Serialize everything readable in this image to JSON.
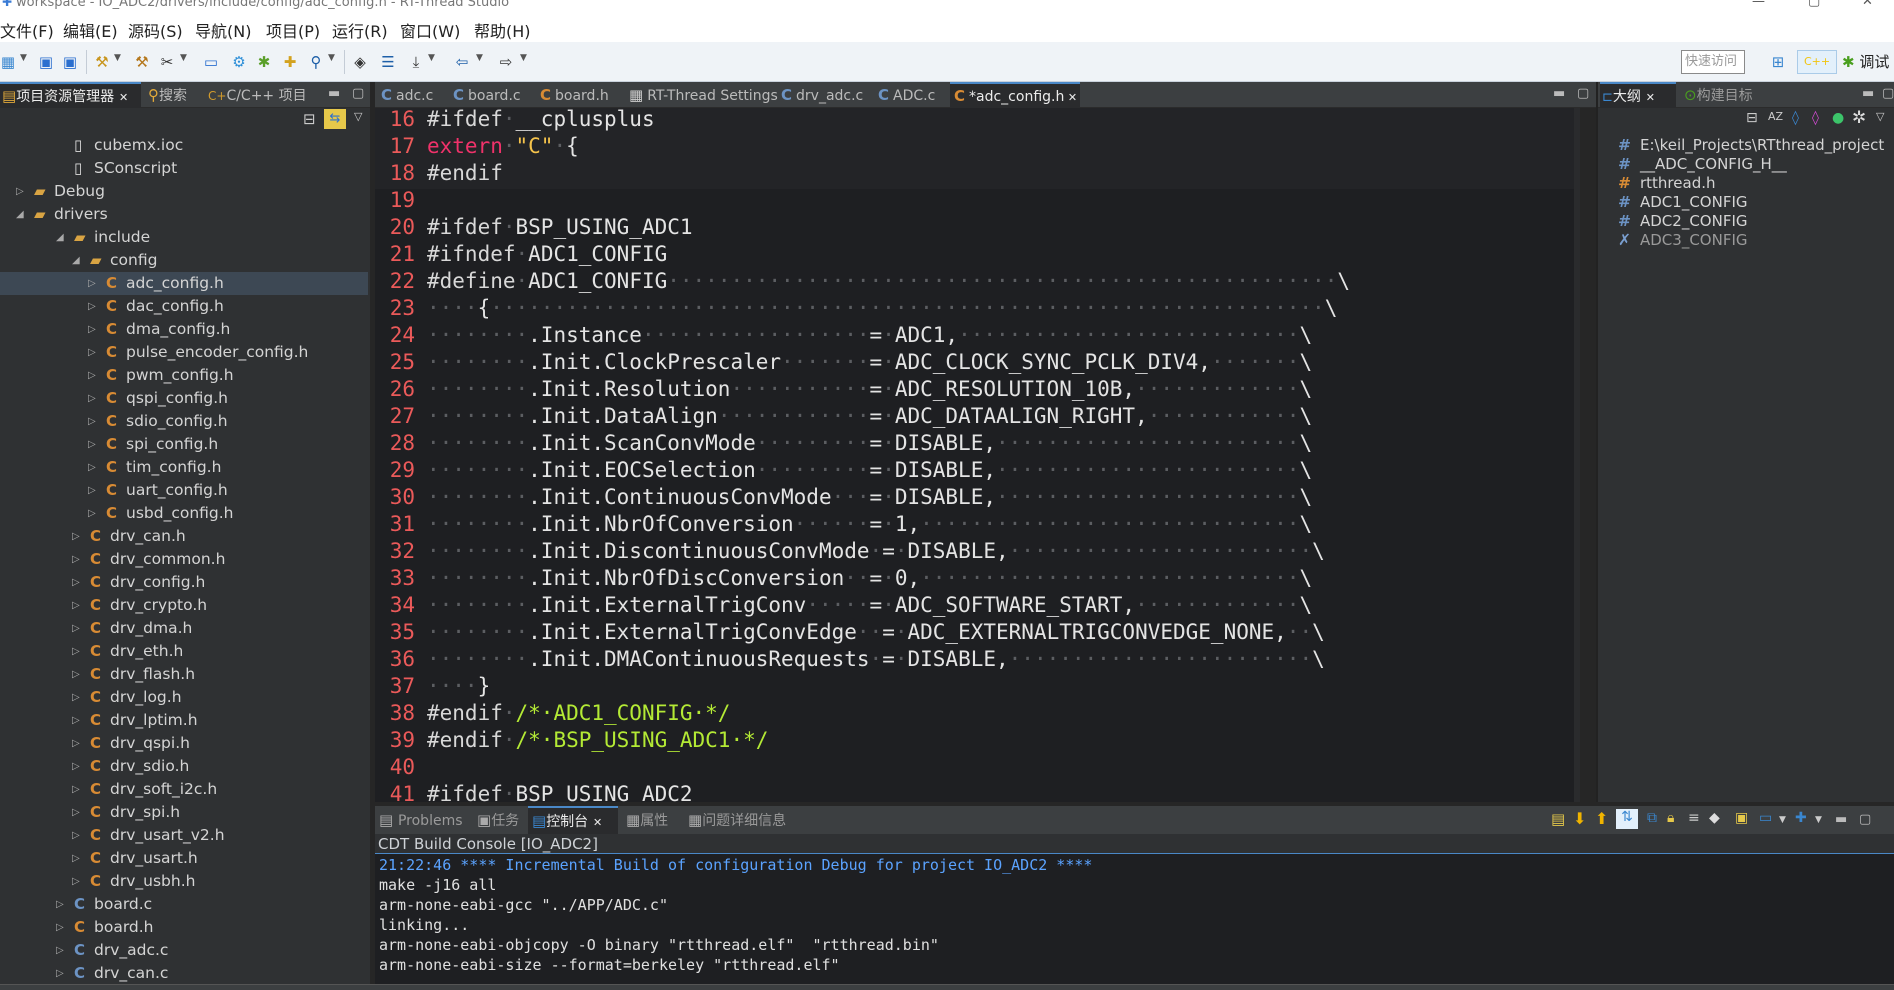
{
  "window": {
    "title": "workspace - IO_ADC2/drivers/include/config/adc_config.h - RT-Thread Studio"
  },
  "menus": [
    "文件(F)",
    "编辑(E)",
    "源码(S)",
    "导航(N)",
    "项目(P)",
    "运行(R)",
    "窗口(W)",
    "帮助(H)"
  ],
  "toolbar": {
    "quick_access": "快速访问",
    "cpp_perspective": "C++",
    "debug_perspective": "调试"
  },
  "left_tabs": [
    "项目资源管理器",
    "搜索",
    "C/C++ 项目"
  ],
  "right_tabs": [
    "大纲",
    "构建目标"
  ],
  "bottom_tabs": [
    "Problems",
    "任务",
    "控制台",
    "属性",
    "问题详细信息"
  ],
  "tree": [
    {
      "indent": 2,
      "label": "cubemx.ioc",
      "icon": "file"
    },
    {
      "indent": 2,
      "label": "SConscript",
      "icon": "file"
    },
    {
      "indent": 1,
      "label": "Debug",
      "icon": "folder",
      "twisty": "closed"
    },
    {
      "indent": 1,
      "label": "drivers",
      "icon": "folder",
      "twisty": "open"
    },
    {
      "indent": 2,
      "label": "include",
      "icon": "folder",
      "twisty": "open"
    },
    {
      "indent": 3,
      "label": "config",
      "icon": "folder",
      "twisty": "open"
    },
    {
      "indent": 4,
      "label": "adc_config.h",
      "icon": "h",
      "twisty": "closed",
      "selected": true
    },
    {
      "indent": 4,
      "label": "dac_config.h",
      "icon": "h",
      "twisty": "closed"
    },
    {
      "indent": 4,
      "label": "dma_config.h",
      "icon": "h",
      "twisty": "closed"
    },
    {
      "indent": 4,
      "label": "pulse_encoder_config.h",
      "icon": "h",
      "twisty": "closed"
    },
    {
      "indent": 4,
      "label": "pwm_config.h",
      "icon": "h",
      "twisty": "closed"
    },
    {
      "indent": 4,
      "label": "qspi_config.h",
      "icon": "h",
      "twisty": "closed"
    },
    {
      "indent": 4,
      "label": "sdio_config.h",
      "icon": "h",
      "twisty": "closed"
    },
    {
      "indent": 4,
      "label": "spi_config.h",
      "icon": "h",
      "twisty": "closed"
    },
    {
      "indent": 4,
      "label": "tim_config.h",
      "icon": "h",
      "twisty": "closed"
    },
    {
      "indent": 4,
      "label": "uart_config.h",
      "icon": "h",
      "twisty": "closed"
    },
    {
      "indent": 4,
      "label": "usbd_config.h",
      "icon": "h",
      "twisty": "closed"
    },
    {
      "indent": 3,
      "label": "drv_can.h",
      "icon": "h",
      "twisty": "closed"
    },
    {
      "indent": 3,
      "label": "drv_common.h",
      "icon": "h",
      "twisty": "closed"
    },
    {
      "indent": 3,
      "label": "drv_config.h",
      "icon": "h",
      "twisty": "closed"
    },
    {
      "indent": 3,
      "label": "drv_crypto.h",
      "icon": "h",
      "twisty": "closed"
    },
    {
      "indent": 3,
      "label": "drv_dma.h",
      "icon": "h",
      "twisty": "closed"
    },
    {
      "indent": 3,
      "label": "drv_eth.h",
      "icon": "h",
      "twisty": "closed"
    },
    {
      "indent": 3,
      "label": "drv_flash.h",
      "icon": "h",
      "twisty": "closed"
    },
    {
      "indent": 3,
      "label": "drv_log.h",
      "icon": "h",
      "twisty": "closed"
    },
    {
      "indent": 3,
      "label": "drv_lptim.h",
      "icon": "h",
      "twisty": "closed"
    },
    {
      "indent": 3,
      "label": "drv_qspi.h",
      "icon": "h",
      "twisty": "closed"
    },
    {
      "indent": 3,
      "label": "drv_sdio.h",
      "icon": "h",
      "twisty": "closed"
    },
    {
      "indent": 3,
      "label": "drv_soft_i2c.h",
      "icon": "h",
      "twisty": "closed"
    },
    {
      "indent": 3,
      "label": "drv_spi.h",
      "icon": "h",
      "twisty": "closed"
    },
    {
      "indent": 3,
      "label": "drv_usart_v2.h",
      "icon": "h",
      "twisty": "closed"
    },
    {
      "indent": 3,
      "label": "drv_usart.h",
      "icon": "h",
      "twisty": "closed"
    },
    {
      "indent": 3,
      "label": "drv_usbh.h",
      "icon": "h",
      "twisty": "closed"
    },
    {
      "indent": 2,
      "label": "board.c",
      "icon": "c",
      "twisty": "closed"
    },
    {
      "indent": 2,
      "label": "board.h",
      "icon": "h",
      "twisty": "closed"
    },
    {
      "indent": 2,
      "label": "drv_adc.c",
      "icon": "c",
      "twisty": "closed"
    },
    {
      "indent": 2,
      "label": "drv_can.c",
      "icon": "c",
      "twisty": "closed"
    }
  ],
  "editor_tabs": [
    {
      "label": "adc.c",
      "icon": "c"
    },
    {
      "label": "board.c",
      "icon": "c"
    },
    {
      "label": "board.h",
      "icon": "h"
    },
    {
      "label": "RT-Thread Settings",
      "icon": "settings"
    },
    {
      "label": "drv_adc.c",
      "icon": "c"
    },
    {
      "label": "ADC.c",
      "icon": "c"
    },
    {
      "label": "*adc_config.h",
      "icon": "h",
      "active": true
    }
  ],
  "code": [
    {
      "n": "16",
      "t": [
        [
          "pp",
          "#ifdef"
        ],
        [
          "ws",
          "·"
        ],
        [
          "",
          "__cplusplus"
        ]
      ]
    },
    {
      "n": "17",
      "t": [
        [
          "kw",
          "extern"
        ],
        [
          "ws",
          "·"
        ],
        [
          "str",
          "\"C\""
        ],
        [
          "ws",
          "·"
        ],
        [
          "",
          "{"
        ]
      ]
    },
    {
      "n": "18",
      "t": [
        [
          "pp",
          "#endif"
        ]
      ]
    },
    {
      "n": "19",
      "t": []
    },
    {
      "n": "20",
      "t": [
        [
          "pp",
          "#ifdef"
        ],
        [
          "ws",
          "·"
        ],
        [
          "",
          "BSP_USING_ADC1"
        ]
      ]
    },
    {
      "n": "21",
      "t": [
        [
          "pp",
          "#ifndef"
        ],
        [
          "ws",
          "·"
        ],
        [
          "",
          "ADC1_CONFIG"
        ]
      ]
    },
    {
      "n": "22",
      "t": [
        [
          "pp",
          "#define"
        ],
        [
          "ws",
          "·"
        ],
        [
          "",
          "ADC1_CONFIG"
        ],
        [
          "ws",
          "·····················································"
        ],
        [
          "",
          "\\"
        ]
      ]
    },
    {
      "n": "23",
      "t": [
        [
          "ws",
          "····"
        ],
        [
          "",
          "{"
        ],
        [
          "ws",
          "··································································"
        ],
        [
          "",
          "\\"
        ]
      ]
    },
    {
      "n": "24",
      "t": [
        [
          "ws",
          "········"
        ],
        [
          "",
          ".Instance"
        ],
        [
          "ws",
          "··················"
        ],
        [
          "",
          "="
        ],
        [
          "ws",
          "·"
        ],
        [
          "",
          "ADC1,"
        ],
        [
          "ws",
          "···························"
        ],
        [
          "",
          "\\"
        ]
      ]
    },
    {
      "n": "25",
      "t": [
        [
          "ws",
          "········"
        ],
        [
          "",
          ".Init.ClockPrescaler"
        ],
        [
          "ws",
          "·······"
        ],
        [
          "",
          "="
        ],
        [
          "ws",
          "·"
        ],
        [
          "",
          "ADC_CLOCK_SYNC_PCLK_DIV4,"
        ],
        [
          "ws",
          "·······"
        ],
        [
          "",
          "\\"
        ]
      ]
    },
    {
      "n": "26",
      "t": [
        [
          "ws",
          "········"
        ],
        [
          "",
          ".Init.Resolution"
        ],
        [
          "ws",
          "···········"
        ],
        [
          "",
          "="
        ],
        [
          "ws",
          "·"
        ],
        [
          "",
          "ADC_RESOLUTION_10B,"
        ],
        [
          "ws",
          "·············"
        ],
        [
          "",
          "\\"
        ]
      ]
    },
    {
      "n": "27",
      "t": [
        [
          "ws",
          "········"
        ],
        [
          "",
          ".Init.DataAlign"
        ],
        [
          "ws",
          "············"
        ],
        [
          "",
          "="
        ],
        [
          "ws",
          "·"
        ],
        [
          "",
          "ADC_DATAALIGN_RIGHT,"
        ],
        [
          "ws",
          "············"
        ],
        [
          "",
          "\\"
        ]
      ]
    },
    {
      "n": "28",
      "t": [
        [
          "ws",
          "········"
        ],
        [
          "",
          ".Init.ScanConvMode"
        ],
        [
          "ws",
          "·········"
        ],
        [
          "",
          "="
        ],
        [
          "ws",
          "·"
        ],
        [
          "",
          "DISABLE,"
        ],
        [
          "ws",
          "························"
        ],
        [
          "",
          "\\"
        ]
      ]
    },
    {
      "n": "29",
      "t": [
        [
          "ws",
          "········"
        ],
        [
          "",
          ".Init.EOCSelection"
        ],
        [
          "ws",
          "·········"
        ],
        [
          "",
          "="
        ],
        [
          "ws",
          "·"
        ],
        [
          "",
          "DISABLE,"
        ],
        [
          "ws",
          "························"
        ],
        [
          "",
          "\\"
        ]
      ]
    },
    {
      "n": "30",
      "t": [
        [
          "ws",
          "········"
        ],
        [
          "",
          ".Init.ContinuousConvMode"
        ],
        [
          "ws",
          "···"
        ],
        [
          "",
          "="
        ],
        [
          "ws",
          "·"
        ],
        [
          "",
          "DISABLE,"
        ],
        [
          "ws",
          "························"
        ],
        [
          "",
          "\\"
        ]
      ]
    },
    {
      "n": "31",
      "t": [
        [
          "ws",
          "········"
        ],
        [
          "",
          ".Init.NbrOfConversion"
        ],
        [
          "ws",
          "······"
        ],
        [
          "",
          "="
        ],
        [
          "ws",
          "·"
        ],
        [
          "",
          "1,"
        ],
        [
          "ws",
          "······························"
        ],
        [
          "",
          "\\"
        ]
      ]
    },
    {
      "n": "32",
      "t": [
        [
          "ws",
          "········"
        ],
        [
          "",
          ".Init.DiscontinuousConvMode"
        ],
        [
          "ws",
          "·"
        ],
        [
          "",
          "="
        ],
        [
          "ws",
          "·"
        ],
        [
          "",
          "DISABLE,"
        ],
        [
          "ws",
          "························"
        ],
        [
          "",
          "\\"
        ]
      ]
    },
    {
      "n": "33",
      "t": [
        [
          "ws",
          "········"
        ],
        [
          "",
          ".Init.NbrOfDiscConversion"
        ],
        [
          "ws",
          "··"
        ],
        [
          "",
          "="
        ],
        [
          "ws",
          "·"
        ],
        [
          "",
          "0,"
        ],
        [
          "ws",
          "······························"
        ],
        [
          "",
          "\\"
        ]
      ]
    },
    {
      "n": "34",
      "t": [
        [
          "ws",
          "········"
        ],
        [
          "",
          ".Init.ExternalTrigConv"
        ],
        [
          "ws",
          "·····"
        ],
        [
          "",
          "="
        ],
        [
          "ws",
          "·"
        ],
        [
          "",
          "ADC_SOFTWARE_START,"
        ],
        [
          "ws",
          "·············"
        ],
        [
          "",
          "\\"
        ]
      ]
    },
    {
      "n": "35",
      "t": [
        [
          "ws",
          "········"
        ],
        [
          "",
          ".Init.ExternalTrigConvEdge"
        ],
        [
          "ws",
          "··"
        ],
        [
          "",
          "="
        ],
        [
          "ws",
          "·"
        ],
        [
          "",
          "ADC_EXTERNALTRIGCONVEDGE_NONE,"
        ],
        [
          "ws",
          "··"
        ],
        [
          "",
          "\\"
        ]
      ]
    },
    {
      "n": "36",
      "t": [
        [
          "ws",
          "········"
        ],
        [
          "",
          ".Init.DMAContinuousRequests"
        ],
        [
          "ws",
          "·"
        ],
        [
          "",
          "="
        ],
        [
          "ws",
          "·"
        ],
        [
          "",
          "DISABLE,"
        ],
        [
          "ws",
          "························"
        ],
        [
          "",
          "\\"
        ]
      ]
    },
    {
      "n": "37",
      "t": [
        [
          "ws",
          "····"
        ],
        [
          "",
          "}"
        ]
      ]
    },
    {
      "n": "38",
      "t": [
        [
          "pp",
          "#endif"
        ],
        [
          "ws",
          "·"
        ],
        [
          "cm",
          "/*·ADC1_CONFIG·*/"
        ]
      ]
    },
    {
      "n": "39",
      "t": [
        [
          "pp",
          "#endif"
        ],
        [
          "ws",
          "·"
        ],
        [
          "cm",
          "/*·BSP_USING_ADC1·*/"
        ]
      ]
    },
    {
      "n": "40",
      "t": []
    },
    {
      "n": "41",
      "t": [
        [
          "pp",
          "#ifdef"
        ],
        [
          "ws",
          "·"
        ],
        [
          "",
          "BSP_USING_ADC2"
        ]
      ]
    }
  ],
  "outline": [
    {
      "icon": "#",
      "label": "E:\\keil_Projects\\RTthread_project"
    },
    {
      "icon": "#",
      "label": "__ADC_CONFIG_H__"
    },
    {
      "icon": "#",
      "label": "rtthread.h"
    },
    {
      "icon": "#",
      "label": "ADC1_CONFIG"
    },
    {
      "icon": "#",
      "label": "ADC2_CONFIG"
    },
    {
      "icon": "x",
      "label": "ADC3_CONFIG"
    }
  ],
  "console": {
    "name": "CDT Build Console [IO_ADC2]",
    "lines": [
      {
        "text": "21:22:46 **** Incremental Build of configuration Debug for project IO_ADC2 ****",
        "color": "#5ba3ff"
      },
      {
        "text": "make -j16 all",
        "color": "#e0e0e0"
      },
      {
        "text": "arm-none-eabi-gcc \"../APP/ADC.c\"",
        "color": "#e0e0e0"
      },
      {
        "text": "linking...",
        "color": "#e0e0e0"
      },
      {
        "text": "arm-none-eabi-objcopy -O binary \"rtthread.elf\"  \"rtthread.bin\"",
        "color": "#e0e0e0"
      },
      {
        "text": "arm-none-eabi-size --format=berkeley \"rtthread.elf\"",
        "color": "#e0e0e0"
      }
    ]
  }
}
